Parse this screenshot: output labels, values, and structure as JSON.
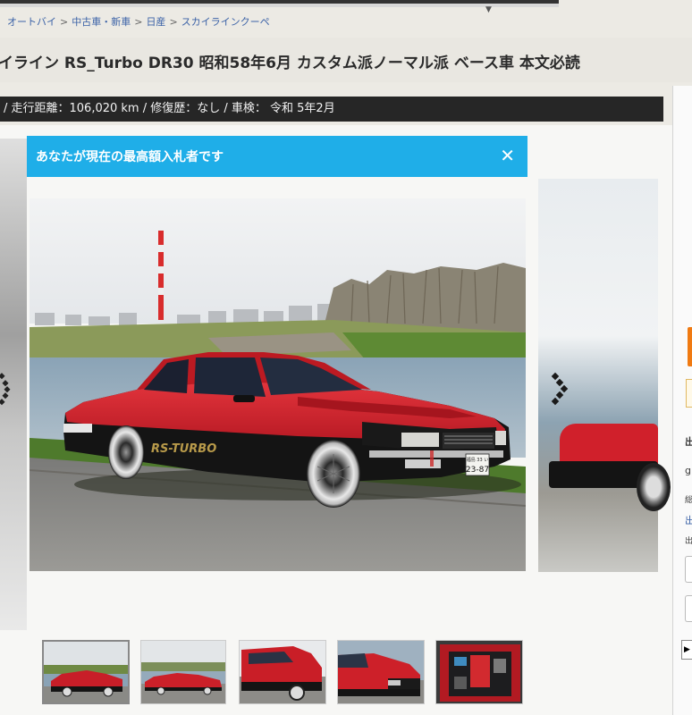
{
  "breadcrumb": {
    "items": [
      "オートバイ",
      "中古車・新車",
      "日産",
      "スカイラインクーペ"
    ],
    "separator": ">"
  },
  "listing": {
    "title": "イライン RS_Turbo DR30 昭和58年6月 カスタム派ノーマル派 ベース車 本文必読",
    "spec_line": "/ 走行距離：106,020 km / 修復歴：なし / 車検： 令和 5年2月"
  },
  "notice": {
    "text": "あなたが現在の最高額入札者です",
    "close_icon": "close-icon"
  },
  "photo": {
    "car_body_color": "#d0202b",
    "car_lower_color": "#121212",
    "decal": "RS-TURBO",
    "plate_top": "福島 33 い",
    "plate_number": "23-87",
    "chimney_color": "#d82c2c"
  },
  "right_panel": {
    "labels": [
      "出",
      "g",
      "総",
      "出",
      "出"
    ]
  },
  "colors": {
    "accent_blue": "#1faee8",
    "spec_bar": "#262626",
    "link": "#3b62a7",
    "orange": "#f07a12"
  }
}
